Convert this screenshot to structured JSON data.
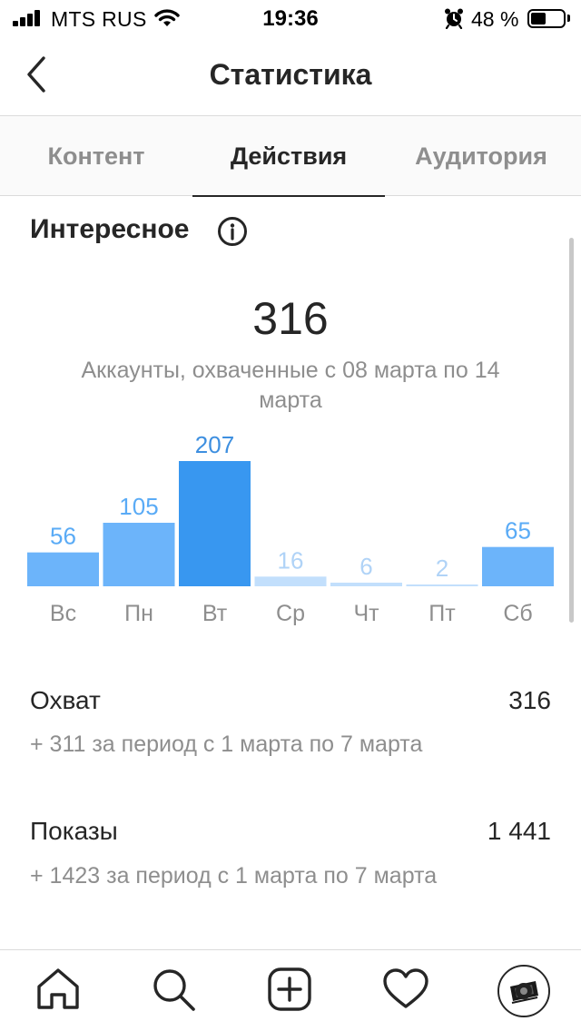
{
  "status_bar": {
    "carrier": "MTS RUS",
    "time": "19:36",
    "battery_percent": "48 %",
    "battery_level": 0.48,
    "icons": [
      "signal-icon",
      "wifi-icon",
      "alarm-icon",
      "battery-icon"
    ]
  },
  "header": {
    "title": "Статистика",
    "back_icon": "chevron-left-icon"
  },
  "tabs": [
    {
      "label": "Контент",
      "active": false
    },
    {
      "label": "Действия",
      "active": true
    },
    {
      "label": "Аудитория",
      "active": false
    }
  ],
  "section": {
    "title": "Интересное",
    "info_icon": "info-icon",
    "total": "316",
    "caption": "Аккаунты, охваченные с 08 марта по 14 марта"
  },
  "chart_data": {
    "type": "bar",
    "categories": [
      "Вс",
      "Пн",
      "Вт",
      "Ср",
      "Чт",
      "Пт",
      "Сб"
    ],
    "values": [
      56,
      105,
      207,
      16,
      6,
      2,
      65
    ],
    "ylim": [
      0,
      207
    ],
    "grid": false,
    "legend": "none",
    "colors": {
      "highlight": "#3897f0",
      "mid": "#6cb4fa",
      "light": "#c2dffc",
      "label_dark": "#3d8fe0",
      "label_mid": "#5aabf6",
      "label_light": "#b0d3f7",
      "tick_label": "#8e8e8e"
    },
    "bar_color_levels": [
      "mid",
      "mid",
      "highlight",
      "light",
      "light",
      "light",
      "mid"
    ]
  },
  "metrics": [
    {
      "label": "Охват",
      "value": "316",
      "sub": "+ 311 за период с 1 марта по 7 марта"
    },
    {
      "label": "Показы",
      "value": "1 441",
      "sub": "+ 1423 за период с 1 марта по 7 марта"
    }
  ],
  "bottom_nav": {
    "icons": [
      "home-icon",
      "search-icon",
      "add-post-icon",
      "heart-icon",
      "profile-avatar"
    ]
  }
}
